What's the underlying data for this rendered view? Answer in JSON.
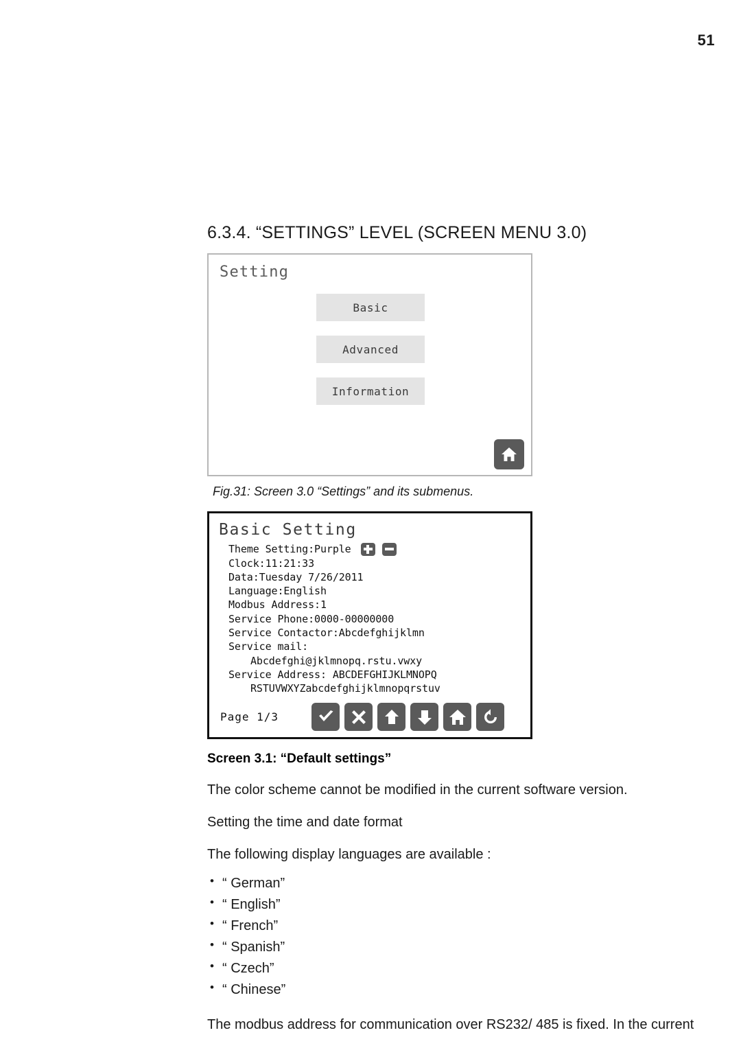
{
  "document": {
    "page_number": "51"
  },
  "section": {
    "heading": "6.3.4. “SETTINGS” LEVEL (SCREEN MENU 3.0)"
  },
  "screen_30": {
    "title": "Setting",
    "menu_buttons": [
      {
        "label": "Basic"
      },
      {
        "label": "Advanced"
      },
      {
        "label": "Information"
      }
    ],
    "home_icon": "home-icon"
  },
  "figure": {
    "caption": "Fig.31:  Screen 3.0 “Settings” and its submenus."
  },
  "screen_31": {
    "title": "Basic Setting",
    "rows": [
      {
        "text": "Theme Setting:Purple",
        "controls": [
          "plus-button",
          "minus-button"
        ],
        "indent": false
      },
      {
        "text": "Clock:11:21:33",
        "indent": false
      },
      {
        "text": "Data:Tuesday  7/26/2011",
        "indent": false
      },
      {
        "text": "Language:English",
        "indent": false
      },
      {
        "text": "Modbus Address:1",
        "indent": false
      },
      {
        "text": "Service Phone:0000-00000000",
        "indent": false
      },
      {
        "text": "Service Contactor:Abcdefghijklmn",
        "indent": false
      },
      {
        "text": "Service mail:",
        "indent": false
      },
      {
        "text": "Abcdefghi@jklmnopq.rstu.vwxy",
        "indent": true
      },
      {
        "text": "Service Address: ABCDEFGHIJKLMNOPQ",
        "indent": false
      },
      {
        "text": "RSTUVWXYZabcdefghijklmnopqrstuv",
        "indent": true
      }
    ],
    "page_indicator": "Page 1/3",
    "toolbar_icons": [
      "check-icon",
      "close-icon",
      "arrow-up-icon",
      "arrow-down-icon",
      "home-icon",
      "refresh-icon"
    ]
  },
  "body": {
    "subheading": "Screen 3.1: “Default settings”",
    "paragraph_1": "The color scheme cannot be modified in the current software version.",
    "paragraph_2": "Setting the time and date format",
    "paragraph_3": "The following display languages are available :",
    "languages": [
      "“ German”",
      "“ English”",
      "“ French”",
      "“ Spanish”",
      "“ Czech”",
      "“ Chinese”"
    ],
    "paragraph_4": "The modbus address for communication over RS232/ 485 is fixed. In the current"
  },
  "colors": {
    "icon_button_fill": "#5a5a5a",
    "menu_button_fill": "#e4e4e4",
    "panel_border_light": "#b7b7b7",
    "panel_border_dark": "#111111"
  }
}
